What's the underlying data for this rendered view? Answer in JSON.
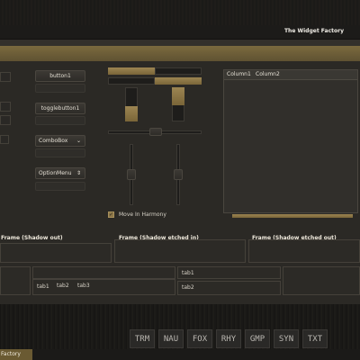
{
  "window": {
    "title": "The Widget Factory"
  },
  "buttons": {
    "button1": "button1",
    "togglebutton1": "togglebutton1",
    "combobox": "ComboBox",
    "optionmenu": "OptionMenu"
  },
  "tree": {
    "columns": [
      "Column1",
      "Column2"
    ]
  },
  "checkbox": {
    "label": "Move In Harmony",
    "checked": true
  },
  "frames": [
    "Frame (Shadow out)",
    "Frame (Shadow etched in)",
    "Frame (Shadow etched out)"
  ],
  "tabs_bottom": [
    "tab1",
    "tab2",
    "tab3"
  ],
  "tabs_side": [
    "tab1",
    "tab2"
  ],
  "dock_items": [
    "TRM",
    "NAU",
    "FOX",
    "RHY",
    "GMP",
    "SYN",
    "TXT"
  ],
  "taskbar": {
    "item": "Factory"
  }
}
